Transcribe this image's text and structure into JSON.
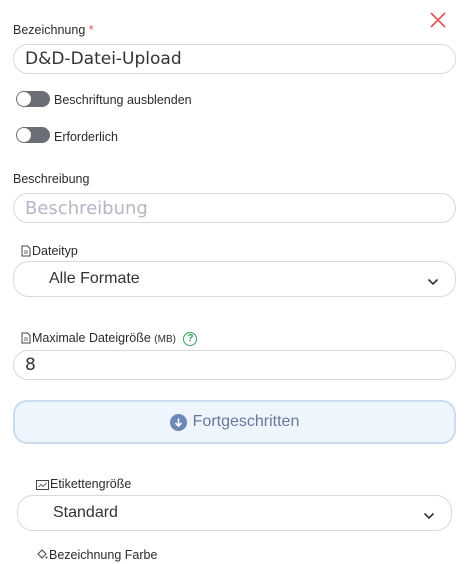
{
  "form": {
    "name_label": "Bezeichnung",
    "required_mark": "*",
    "name_value": "D&D-Datei-Upload",
    "hide_label_toggle": {
      "label": "Beschriftung ausblenden",
      "on": false
    },
    "required_toggle": {
      "label": "Erforderlich",
      "on": false
    },
    "description_label": "Beschreibung",
    "description_placeholder": "Beschreibung",
    "filetype_label": "Dateityp",
    "filetype_value": "Alle Formate",
    "max_size_label": "Maximale Dateigröße",
    "max_size_unit": "(MB)",
    "help_icon_text": "?",
    "max_size_value": "8",
    "advanced_button": "Fortgeschritten",
    "label_size_label": "Etikettengröße",
    "label_size_value": "Standard",
    "label_color_label": "Bezeichnung Farbe"
  },
  "icons": {
    "close": "close-icon",
    "file": "file-icon",
    "chevron": "chevron-down-icon",
    "advanced": "arrow-down-circle-icon",
    "label_size": "tag-icon",
    "color": "paint-bucket-icon"
  },
  "colors": {
    "close": "#e25555",
    "toggle_off": "#6b6f75",
    "advanced_bg": "#eef5fd",
    "advanced_border": "#c9dcf2",
    "help": "#2fa05a"
  }
}
